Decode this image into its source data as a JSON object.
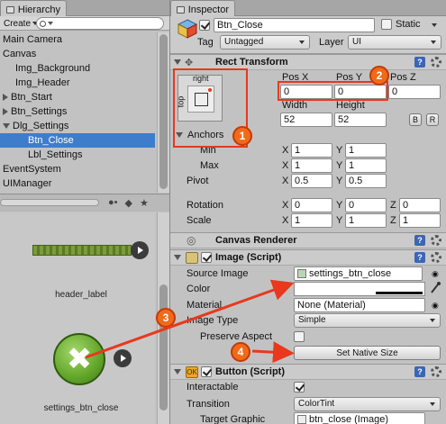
{
  "hierarchy": {
    "tab_title": "Hierarchy",
    "create_label": "Create",
    "items": [
      {
        "label": "Main Camera",
        "indent": 0,
        "fold": "",
        "selected": false
      },
      {
        "label": "Canvas",
        "indent": 0,
        "fold": "",
        "selected": false
      },
      {
        "label": "Img_Background",
        "indent": 1,
        "fold": "",
        "selected": false
      },
      {
        "label": "Img_Header",
        "indent": 1,
        "fold": "",
        "selected": false
      },
      {
        "label": "Btn_Start",
        "indent": 0,
        "fold": "right",
        "selected": false
      },
      {
        "label": "Btn_Settings",
        "indent": 0,
        "fold": "right",
        "selected": false
      },
      {
        "label": "Dlg_Settings",
        "indent": 0,
        "fold": "down",
        "selected": false
      },
      {
        "label": "Btn_Close",
        "indent": 2,
        "fold": "",
        "selected": true
      },
      {
        "label": "Lbl_Settings",
        "indent": 2,
        "fold": "",
        "selected": false
      },
      {
        "label": "EventSystem",
        "indent": 0,
        "fold": "",
        "selected": false
      },
      {
        "label": "UIManager",
        "indent": 0,
        "fold": "",
        "selected": false
      }
    ]
  },
  "assets": {
    "header_label": "header_label",
    "close_label": "settings_btn_close"
  },
  "inspector": {
    "tab_title": "Inspector",
    "name": "Btn_Close",
    "static_label": "Static",
    "tag_label": "Tag",
    "tag_value": "Untagged",
    "layer_label": "Layer",
    "layer_value": "UI"
  },
  "rect_transform": {
    "title": "Rect Transform",
    "anchor_preset_top": "right",
    "anchor_preset_side": "top",
    "pos_x_label": "Pos X",
    "pos_y_label": "Pos Y",
    "pos_z_label": "Pos Z",
    "pos_x": "0",
    "pos_y": "0",
    "pos_z": "0",
    "width_label": "Width",
    "height_label": "Height",
    "width": "52",
    "height": "52",
    "blueprint_btn": "B",
    "raw_btn": "R",
    "anchors_label": "Anchors",
    "min_label": "Min",
    "max_label": "Max",
    "pivot_label": "Pivot",
    "rotation_label": "Rotation",
    "scale_label": "Scale",
    "min": {
      "x": "1",
      "y": "1"
    },
    "max": {
      "x": "1",
      "y": "1"
    },
    "pivot": {
      "x": "0.5",
      "y": "0.5"
    },
    "rotation": {
      "x": "0",
      "y": "0",
      "z": "0"
    },
    "scale": {
      "x": "1",
      "y": "1",
      "z": "1"
    }
  },
  "canvas_renderer": {
    "title": "Canvas Renderer"
  },
  "image_script": {
    "title": "Image (Script)",
    "source_image_label": "Source Image",
    "source_image_value": "settings_btn_close",
    "color_label": "Color",
    "material_label": "Material",
    "material_value": "None (Material)",
    "image_type_label": "Image Type",
    "image_type_value": "Simple",
    "preserve_aspect_label": "Preserve Aspect",
    "set_native_size": "Set Native Size"
  },
  "button_script": {
    "title": "Button (Script)",
    "interactable_label": "Interactable",
    "transition_label": "Transition",
    "transition_value": "ColorTint",
    "target_graphic_label": "Target Graphic",
    "target_graphic_value": "btn_close (Image)"
  },
  "annotations": {
    "b1": "1",
    "b2": "2",
    "b3": "3",
    "b4": "4"
  },
  "colors": {
    "selection": "#3e7dcc",
    "annotation": "#e8381d",
    "badge": "#f16a1a"
  }
}
